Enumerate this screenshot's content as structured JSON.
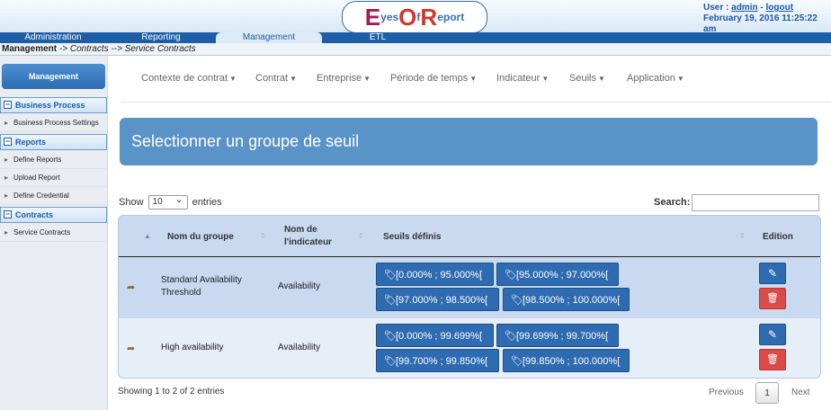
{
  "logo": {
    "e": "E",
    "yes": "yes",
    "o": "O",
    "f": "f",
    "r": "R",
    "eport": "eport"
  },
  "user": {
    "label": "User :",
    "name": "admin",
    "sep": "-",
    "logout": "logout",
    "datetime": "February 19, 2016 11:25:22 am"
  },
  "topnav": [
    "Administration",
    "Reporting",
    "Management",
    "ETL"
  ],
  "breadcrumb": {
    "root": "Management",
    "path": "-> Contracts --> Service Contracts"
  },
  "sidebar": {
    "title": "Management",
    "groups": [
      {
        "label": "Business Process",
        "items": [
          "Business Process Settings"
        ]
      },
      {
        "label": "Reports",
        "items": [
          "Define Reports",
          "Upload Report",
          "Define Credential"
        ]
      },
      {
        "label": "Contracts",
        "items": [
          "Service Contracts"
        ]
      }
    ]
  },
  "filters": [
    "Contexte de contrat",
    "Contrat",
    "Entreprise",
    "Période de temps",
    "Indicateur",
    "Seuils",
    "Application"
  ],
  "panel_title": "Selectionner un groupe de seuil",
  "length": {
    "show": "Show",
    "value": "10",
    "entries": "entries"
  },
  "search": {
    "label": "Search:",
    "value": ""
  },
  "table": {
    "headers": [
      "Nom du groupe",
      "Nom de l'indicateur",
      "Seuils définis",
      "Edition"
    ],
    "header_indicator_lines": [
      "Nom de",
      "l'indicateur"
    ],
    "rows": [
      {
        "group_lines": [
          "Standard Availability",
          "Threshold"
        ],
        "indicator": "Availability",
        "thresholds": [
          "[0.000% ; 95.000%[",
          "[95.000% ; 97.000%[",
          "[97.000% ; 98.500%[",
          "[98.500% ; 100.000%["
        ]
      },
      {
        "group_lines": [
          "High availability"
        ],
        "indicator": "Availability",
        "thresholds": [
          "[0.000% ; 99.699%[",
          "[99.699% ; 99.700%[",
          "[99.700% ; 99.850%[",
          "[99.850% ; 100.000%["
        ]
      }
    ]
  },
  "info": "Showing 1 to 2 of 2 entries",
  "pager": {
    "previous": "Previous",
    "current": "1",
    "next": "Next"
  },
  "colors": {
    "brand_blue": "#1d5ea6",
    "panel": "#5a93c8",
    "tag": "#2e6bb0",
    "delete": "#d94a48"
  },
  "icons": {
    "tag": "tag-icon",
    "edit": "pencil-icon",
    "delete": "trash-icon",
    "row": "share-arrow-icon"
  }
}
